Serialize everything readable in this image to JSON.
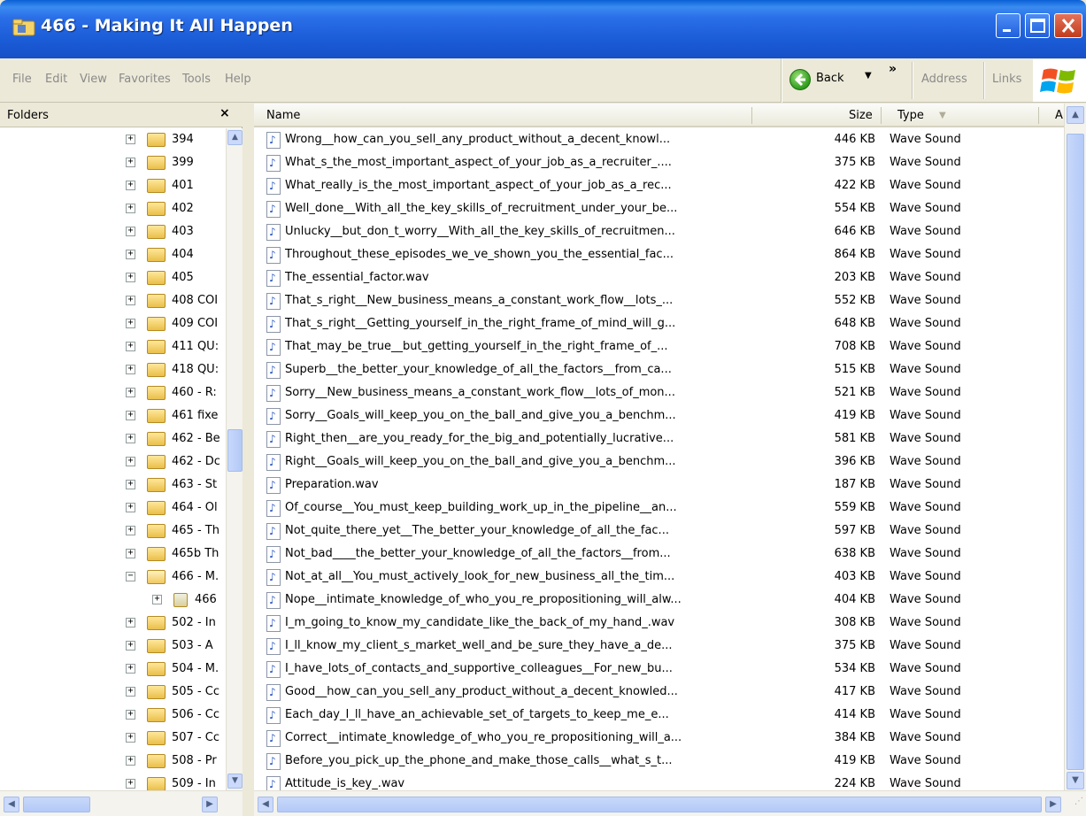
{
  "window": {
    "title": "466 - Making It All Happen"
  },
  "menu": {
    "items": [
      "File",
      "Edit",
      "View",
      "Favorites",
      "Tools",
      "Help"
    ],
    "back_label": "Back",
    "chevrons": "»",
    "address_label": "Address",
    "links_label": "Links"
  },
  "folders": {
    "title": "Folders",
    "close": "×",
    "tree": [
      {
        "label": "394",
        "exp": "+"
      },
      {
        "label": "399",
        "exp": "+"
      },
      {
        "label": "401",
        "exp": "+"
      },
      {
        "label": "402",
        "exp": "+"
      },
      {
        "label": "403",
        "exp": "+"
      },
      {
        "label": "404",
        "exp": "+"
      },
      {
        "label": "405",
        "exp": "+"
      },
      {
        "label": "408 COI",
        "exp": "+"
      },
      {
        "label": "409 COI",
        "exp": "+"
      },
      {
        "label": "411 QU:",
        "exp": "+"
      },
      {
        "label": "418 QU:",
        "exp": "+"
      },
      {
        "label": "460 - R:",
        "exp": "+"
      },
      {
        "label": "461 fixe",
        "exp": "+"
      },
      {
        "label": "462 - Be",
        "exp": "+"
      },
      {
        "label": "462 - Dc",
        "exp": "+"
      },
      {
        "label": "463 - St",
        "exp": "+"
      },
      {
        "label": "464 - Ol",
        "exp": "+"
      },
      {
        "label": "465 - Th",
        "exp": "+"
      },
      {
        "label": "465b Th",
        "exp": "+"
      },
      {
        "label": "466 - M.",
        "exp": "−",
        "open": true
      },
      {
        "label": "466",
        "exp": "+",
        "child": true
      },
      {
        "label": "502 - In",
        "exp": "+"
      },
      {
        "label": "503 - A",
        "exp": "+"
      },
      {
        "label": "504 - M.",
        "exp": "+"
      },
      {
        "label": "505 - Cc",
        "exp": "+"
      },
      {
        "label": "506 - Cc",
        "exp": "+"
      },
      {
        "label": "507 - Cc",
        "exp": "+"
      },
      {
        "label": "508 - Pr",
        "exp": "+"
      },
      {
        "label": "509 - In",
        "exp": "+"
      }
    ]
  },
  "columns": {
    "name": "Name",
    "size": "Size",
    "type": "Type",
    "extra": "A"
  },
  "files": [
    {
      "name": "Wrong__how_can_you_sell_any_product_without_a_decent_knowl...",
      "size": "446 KB",
      "type": "Wave Sound"
    },
    {
      "name": "What_s_the_most_important_aspect_of_your_job_as_a_recruiter_....",
      "size": "375 KB",
      "type": "Wave Sound"
    },
    {
      "name": "What_really_is_the_most_important_aspect_of_your_job_as_a_rec...",
      "size": "422 KB",
      "type": "Wave Sound"
    },
    {
      "name": "Well_done__With_all_the_key_skills_of_recruitment_under_your_be...",
      "size": "554 KB",
      "type": "Wave Sound"
    },
    {
      "name": "Unlucky__but_don_t_worry__With_all_the_key_skills_of_recruitmen...",
      "size": "646 KB",
      "type": "Wave Sound"
    },
    {
      "name": "Throughout_these_episodes_we_ve_shown_you_the_essential_fac...",
      "size": "864 KB",
      "type": "Wave Sound"
    },
    {
      "name": "The_essential_factor.wav",
      "size": "203 KB",
      "type": "Wave Sound"
    },
    {
      "name": "That_s_right__New_business_means_a_constant_work_flow__lots_...",
      "size": "552 KB",
      "type": "Wave Sound"
    },
    {
      "name": "That_s_right__Getting_yourself_in_the_right_frame_of_mind_will_g...",
      "size": "648 KB",
      "type": "Wave Sound"
    },
    {
      "name": "That_may_be_true__but_getting_yourself_in_the_right_frame_of_...",
      "size": "708 KB",
      "type": "Wave Sound"
    },
    {
      "name": "Superb__the_better_your_knowledge_of_all_the_factors__from_ca...",
      "size": "515 KB",
      "type": "Wave Sound"
    },
    {
      "name": "Sorry__New_business_means_a_constant_work_flow__lots_of_mon...",
      "size": "521 KB",
      "type": "Wave Sound"
    },
    {
      "name": "Sorry__Goals_will_keep_you_on_the_ball_and_give_you_a_benchm...",
      "size": "419 KB",
      "type": "Wave Sound"
    },
    {
      "name": "Right_then__are_you_ready_for_the_big_and_potentially_lucrative...",
      "size": "581 KB",
      "type": "Wave Sound"
    },
    {
      "name": "Right__Goals_will_keep_you_on_the_ball_and_give_you_a_benchm...",
      "size": "396 KB",
      "type": "Wave Sound"
    },
    {
      "name": "Preparation.wav",
      "size": "187 KB",
      "type": "Wave Sound"
    },
    {
      "name": "Of_course__You_must_keep_building_work_up_in_the_pipeline__an...",
      "size": "559 KB",
      "type": "Wave Sound"
    },
    {
      "name": "Not_quite_there_yet__The_better_your_knowledge_of_all_the_fac...",
      "size": "597 KB",
      "type": "Wave Sound"
    },
    {
      "name": "Not_bad____the_better_your_knowledge_of_all_the_factors__from...",
      "size": "638 KB",
      "type": "Wave Sound"
    },
    {
      "name": "Not_at_all__You_must_actively_look_for_new_business_all_the_tim...",
      "size": "403 KB",
      "type": "Wave Sound"
    },
    {
      "name": "Nope__intimate_knowledge_of_who_you_re_propositioning_will_alw...",
      "size": "404 KB",
      "type": "Wave Sound"
    },
    {
      "name": "I_m_going_to_know_my_candidate_like_the_back_of_my_hand_.wav",
      "size": "308 KB",
      "type": "Wave Sound"
    },
    {
      "name": "I_ll_know_my_client_s_market_well_and_be_sure_they_have_a_de...",
      "size": "375 KB",
      "type": "Wave Sound"
    },
    {
      "name": "I_have_lots_of_contacts_and_supportive_colleagues__For_new_bu...",
      "size": "534 KB",
      "type": "Wave Sound"
    },
    {
      "name": "Good__how_can_you_sell_any_product_without_a_decent_knowled...",
      "size": "417 KB",
      "type": "Wave Sound"
    },
    {
      "name": "Each_day_I_ll_have_an_achievable_set_of_targets_to_keep_me_e...",
      "size": "414 KB",
      "type": "Wave Sound"
    },
    {
      "name": "Correct__intimate_knowledge_of_who_you_re_propositioning_will_a...",
      "size": "384 KB",
      "type": "Wave Sound"
    },
    {
      "name": "Before_you_pick_up_the_phone_and_make_those_calls__what_s_t...",
      "size": "419 KB",
      "type": "Wave Sound"
    },
    {
      "name": "Attitude_is_key_.wav",
      "size": "224 KB",
      "type": "Wave Sound"
    }
  ]
}
